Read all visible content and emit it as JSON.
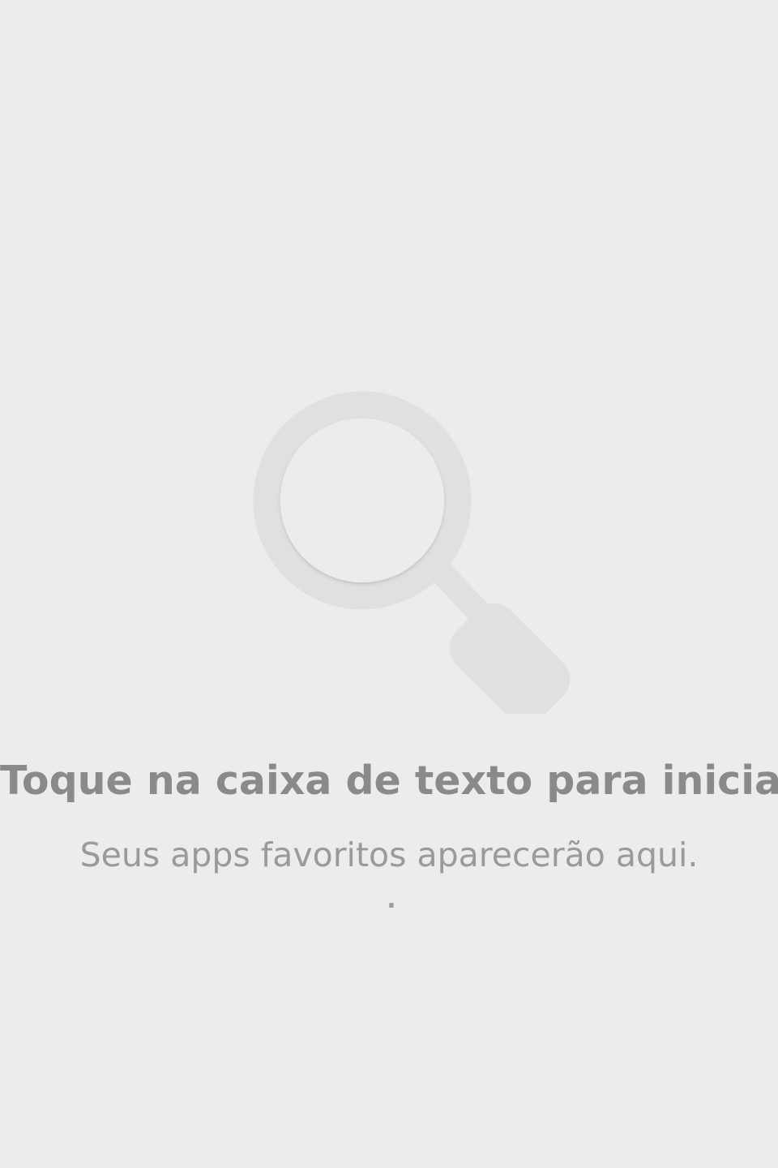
{
  "empty_state": {
    "icon": "search-icon",
    "title": "Toque na caixa de texto para iniciar.",
    "subtitle": "Seus apps favoritos aparecerão aqui.",
    "dot": "."
  },
  "colors": {
    "background": "#ececec",
    "icon": "#e0e0e0",
    "title": "#8a8a8a",
    "subtitle": "#9a9a9a"
  }
}
